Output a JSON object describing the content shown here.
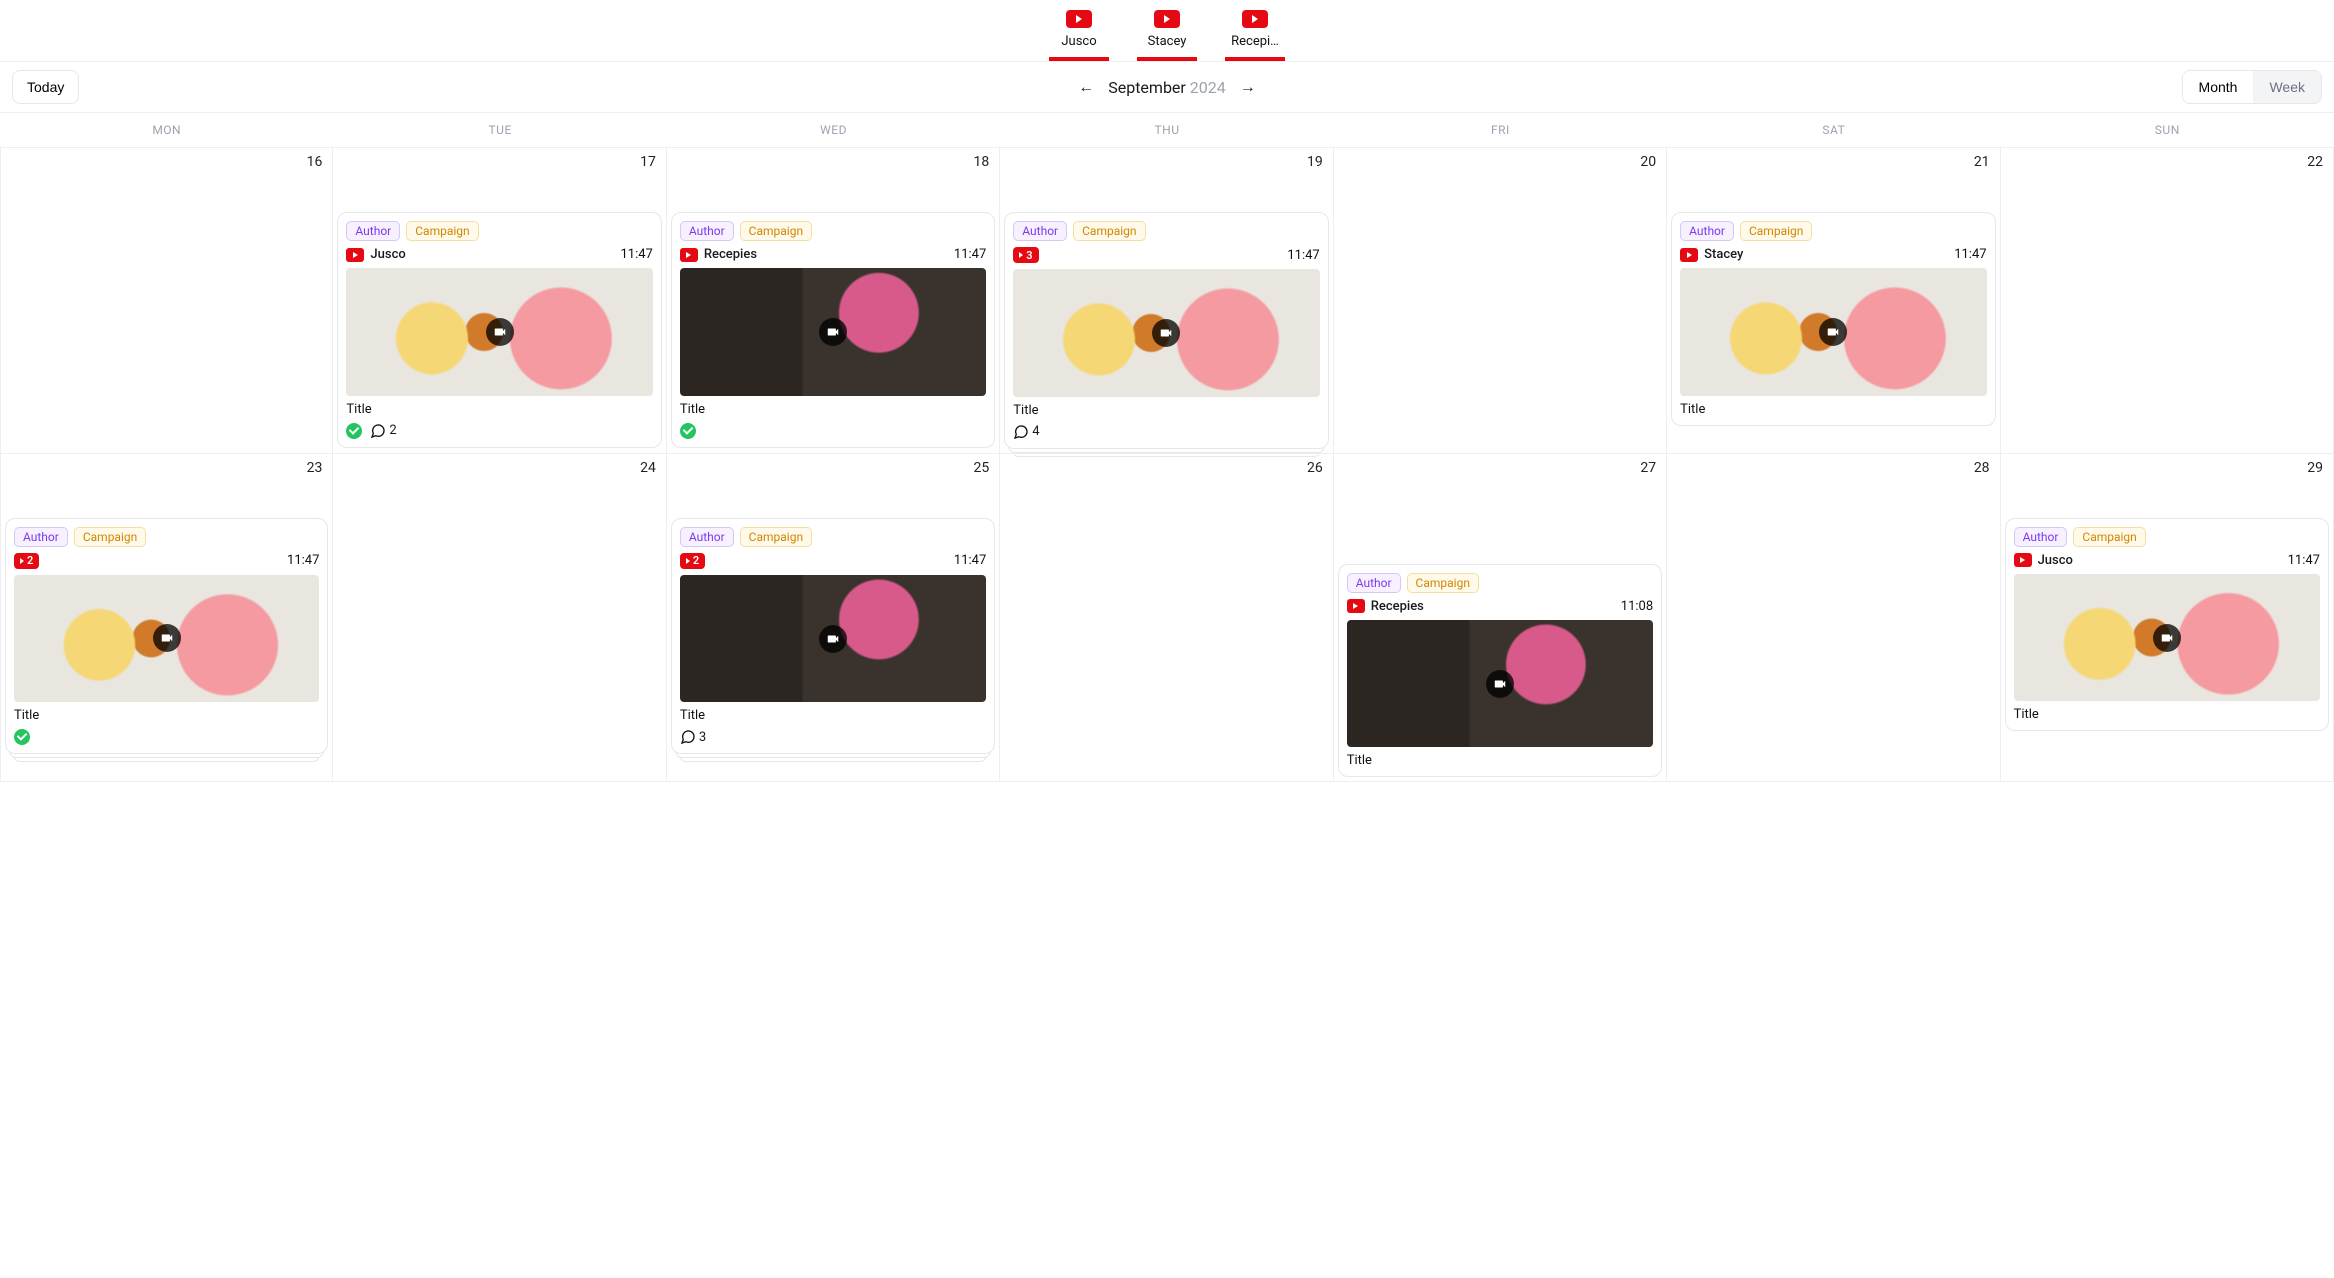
{
  "channels": [
    {
      "label": "Jusco"
    },
    {
      "label": "Stacey"
    },
    {
      "label": "Recepi…"
    }
  ],
  "toolbar": {
    "today": "Today",
    "month": "September",
    "year": "2024",
    "view_month": "Month",
    "view_week": "Week"
  },
  "dow": [
    "MON",
    "TUE",
    "WED",
    "THU",
    "FRI",
    "SAT",
    "SUN"
  ],
  "weeks": [
    [
      {
        "num": "16"
      },
      {
        "num": "17",
        "card": {
          "author": "Author",
          "campaign": "Campaign",
          "channel": "Jusco",
          "time": "11:47",
          "thumb": "citrus",
          "title": "Title",
          "check": true,
          "comments": "2"
        }
      },
      {
        "num": "18",
        "card": {
          "author": "Author",
          "campaign": "Campaign",
          "channel": "Recepies",
          "time": "11:47",
          "thumb": "glass",
          "title": "Title",
          "check": true
        }
      },
      {
        "num": "19",
        "card": {
          "author": "Author",
          "campaign": "Campaign",
          "count": "3",
          "time": "11:47",
          "thumb": "citrus",
          "title": "Title",
          "comments": "4",
          "stacked": true
        }
      },
      {
        "num": "20"
      },
      {
        "num": "21",
        "card": {
          "author": "Author",
          "campaign": "Campaign",
          "channel": "Stacey",
          "time": "11:47",
          "thumb": "citrus",
          "title": "Title"
        }
      },
      {
        "num": "22"
      }
    ],
    [
      {
        "num": "23",
        "card": {
          "author": "Author",
          "campaign": "Campaign",
          "count": "2",
          "time": "11:47",
          "thumb": "citrus",
          "title": "Title",
          "check": true,
          "stacked": true
        }
      },
      {
        "num": "24"
      },
      {
        "num": "25",
        "card": {
          "author": "Author",
          "campaign": "Campaign",
          "count": "2",
          "time": "11:47",
          "thumb": "glass",
          "title": "Title",
          "comments": "3",
          "stacked": true
        }
      },
      {
        "num": "26"
      },
      {
        "num": "27",
        "card": {
          "author": "Author",
          "campaign": "Campaign",
          "channel": "Recepies",
          "time": "11:08",
          "thumb": "glass",
          "title": "Title",
          "late": true
        }
      },
      {
        "num": "28"
      },
      {
        "num": "29",
        "card": {
          "author": "Author",
          "campaign": "Campaign",
          "channel": "Jusco",
          "time": "11:47",
          "thumb": "citrus",
          "title": "Title"
        }
      }
    ]
  ]
}
